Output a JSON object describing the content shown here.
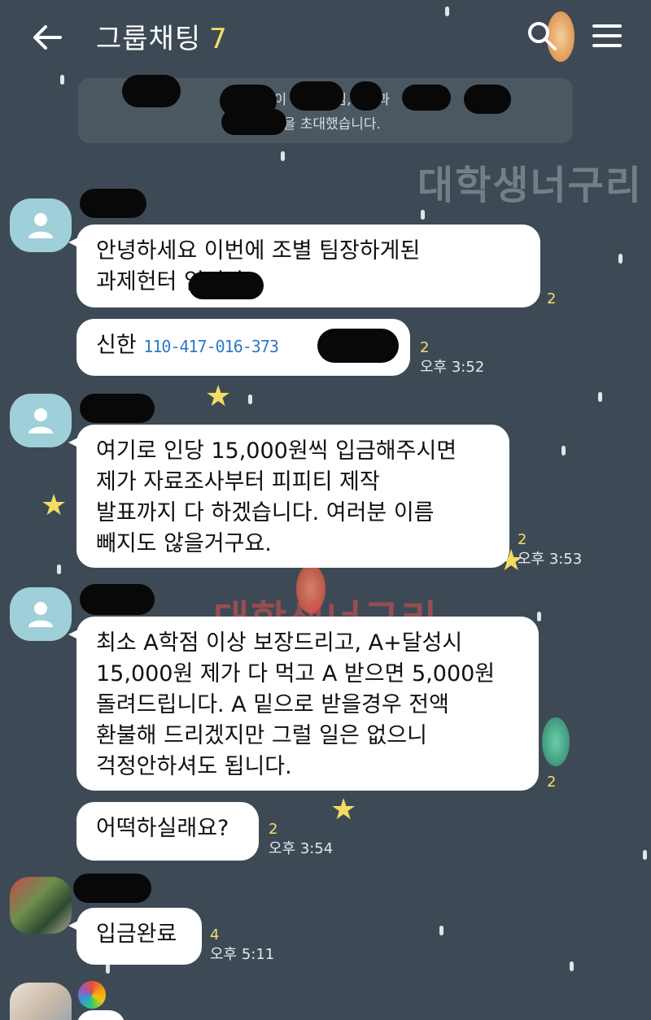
{
  "header": {
    "back_icon": "arrow-left-icon",
    "title": "그룹채팅",
    "member_count": "7",
    "search_icon": "search-icon",
    "menu_icon": "hamburger-menu-icon"
  },
  "system_notice": {
    "line1": "님이     님,   님,   님,       님,       과",
    "line2": "님을 초대했습니다."
  },
  "watermark": "대학생너구리",
  "messages": [
    {
      "text_lines": [
        "안녕하세요 이번에 조별 팀장하게된",
        "과제헌터          입니다."
      ],
      "unread": "2",
      "time": ""
    },
    {
      "text_lines": [
        "신한"
      ],
      "account_blur": "110-417-016-373",
      "unread": "2",
      "time": "오후 3:52"
    },
    {
      "text_lines": [
        "여기로 인당 15,000원씩 입금해주시면",
        "제가 자료조사부터 피피티 제작",
        "발표까지 다 하겠습니다. 여러분 이름",
        "빼지도 않을거구요."
      ],
      "unread": "2",
      "time": "오후 3:53"
    },
    {
      "text_lines": [
        "최소 A학점 이상 보장드리고, A+달성시",
        "15,000원 제가 다 먹고 A 받으면 5,000원",
        "돌려드립니다. A 밑으로 받을경우 전액",
        "환불해 드리겠지만 그럴 일은 없으니",
        "걱정안하셔도 됩니다."
      ],
      "unread": "2",
      "time": ""
    },
    {
      "text_lines": [
        "어떡하실래요?"
      ],
      "unread": "2",
      "time": "오후 3:54"
    },
    {
      "text_lines": [
        "입금완료"
      ],
      "unread": "4",
      "time": "오후 5:11"
    }
  ],
  "colors": {
    "background": "#3d4a55",
    "bubble": "#ffffff",
    "unread_count": "#f2df6b",
    "title_count": "#f2df6b"
  }
}
